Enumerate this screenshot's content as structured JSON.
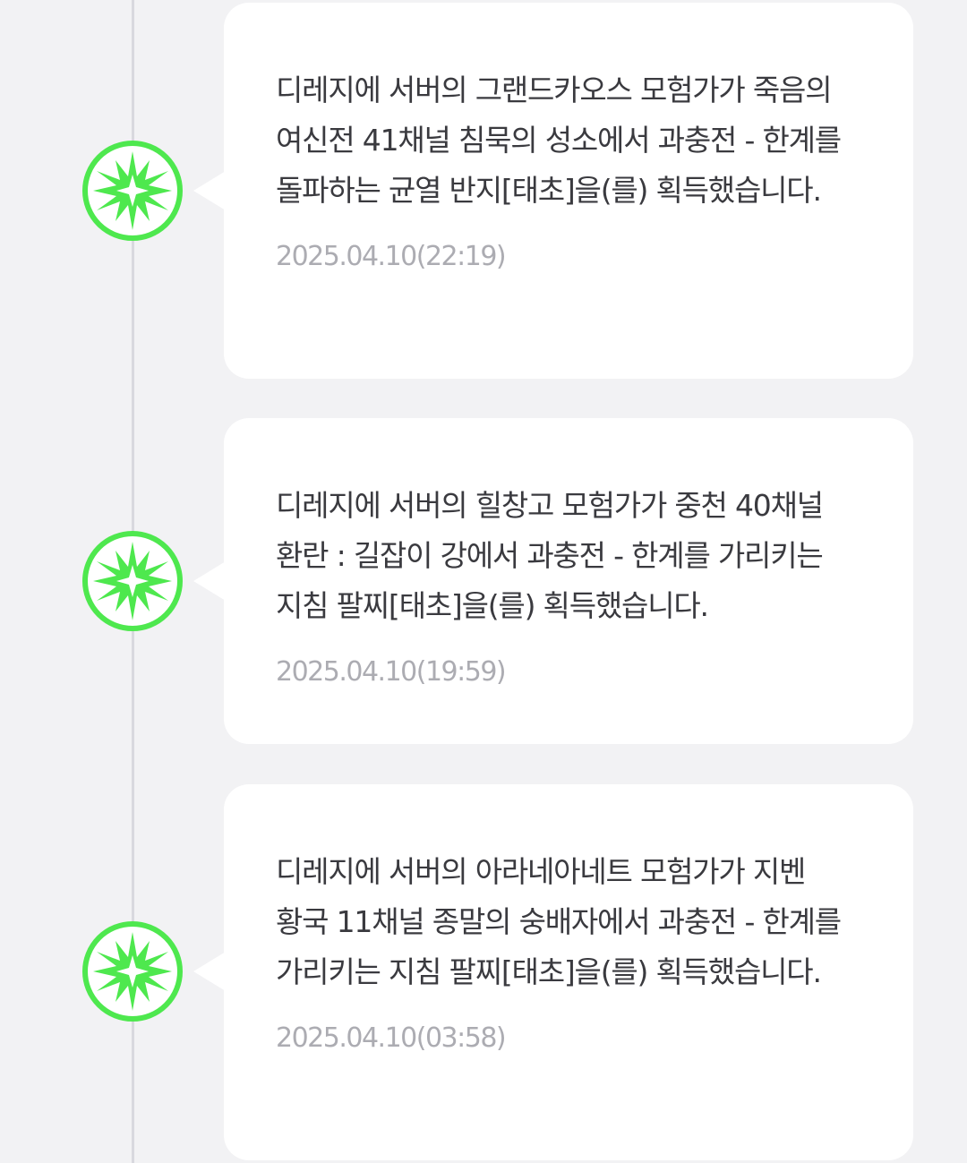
{
  "timeline": {
    "items": [
      {
        "message": "디레지에 서버의 그랜드카오스 모험가가 죽음의 여신전 41채널 침묵의 성소에서 과충전 - 한계를 돌파하는 균열 반지[태초]을(를) 획득했습니다.",
        "timestamp": "2025.04.10(22:19)",
        "icon": "green-starburst-icon"
      },
      {
        "message": "디레지에 서버의 힐창고 모험가가 중천 40채널 환란 : 길잡이 강에서 과충전 - 한계를 가리키는 지침 팔찌[태초]을(를) 획득했습니다.",
        "timestamp": "2025.04.10(19:59)",
        "icon": "green-starburst-icon"
      },
      {
        "message": "디레지에 서버의 아라네아네트 모험가가 지벤 황국 11채널 종말의 숭배자에서 과충전 - 한계를 가리키는 지침 팔찌[태초]을(를) 획득했습니다.",
        "timestamp": "2025.04.10(03:58)",
        "icon": "green-starburst-icon"
      }
    ]
  },
  "colors": {
    "background": "#f2f2f4",
    "card": "#ffffff",
    "timeline_line": "#d9d9de",
    "message_text": "#3a3a3f",
    "timestamp_text": "#acacb2",
    "badge_green": "#4ee84e"
  }
}
